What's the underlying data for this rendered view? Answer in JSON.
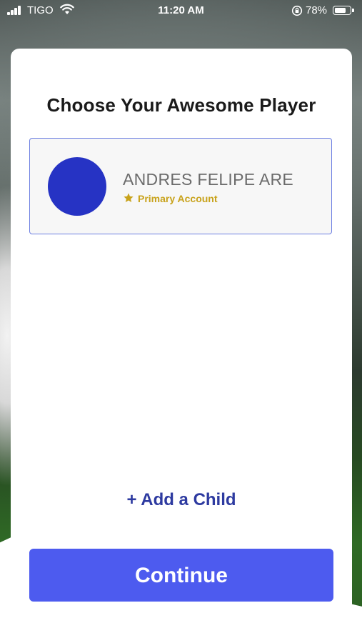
{
  "status_bar": {
    "carrier": "TIGO",
    "time": "11:20 AM",
    "battery_percent": "78%",
    "battery_level": 0.78,
    "icons": [
      "signal-icon",
      "wifi-icon",
      "orientation-lock-icon",
      "battery-icon"
    ]
  },
  "dialog": {
    "title": "Choose Your Awesome Player",
    "player": {
      "name": "ANDRES FELIPE ARE",
      "badge": "Primary Account",
      "avatar_color": "#2633c4",
      "badge_color": "#c8a21a"
    },
    "add_child_label": "+ Add a Child",
    "continue_label": "Continue"
  },
  "colors": {
    "accent": "#4d5bef",
    "link": "#2d3aa0",
    "selected_border": "#6d7fe2"
  }
}
